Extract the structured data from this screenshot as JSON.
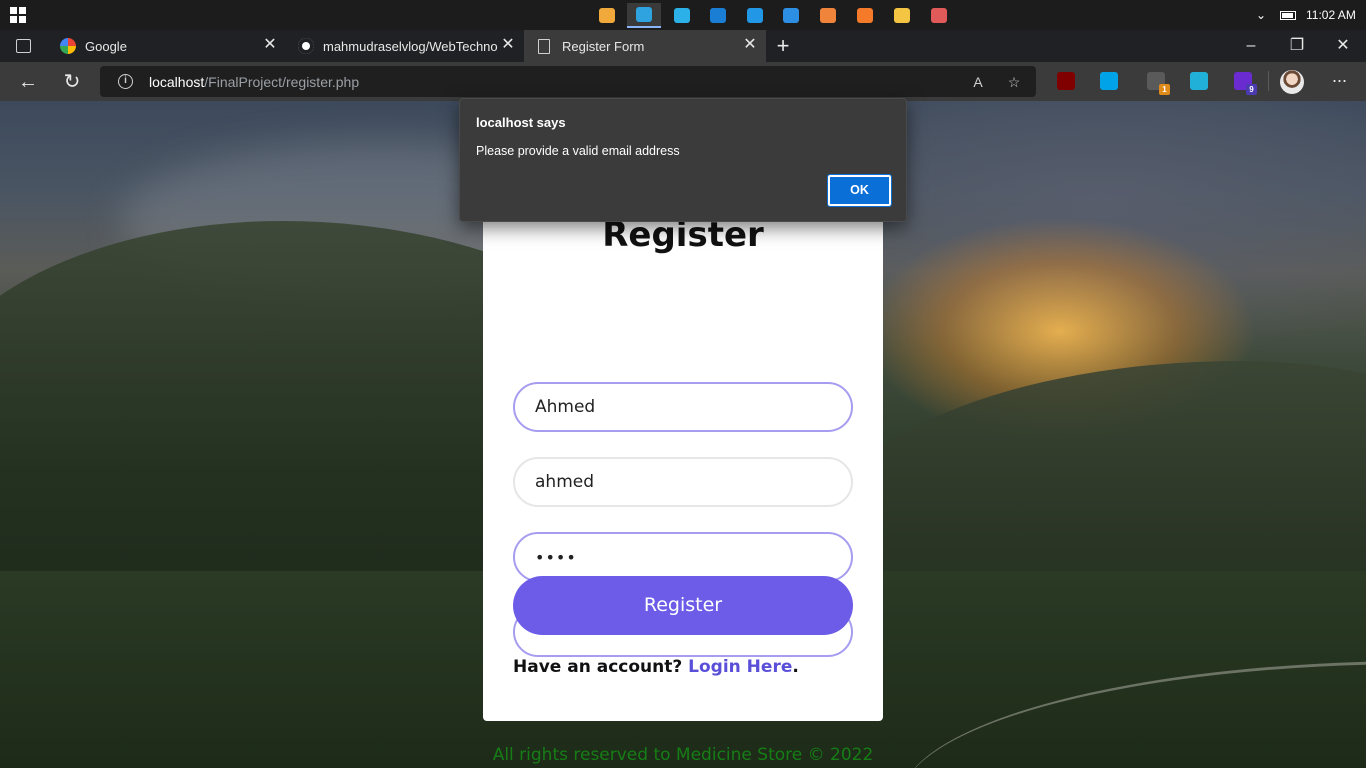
{
  "taskbar": {
    "apps": [
      {
        "name": "task-view",
        "color": "#f2a93b"
      },
      {
        "name": "edge",
        "color": "#2fa3e0",
        "active": true
      },
      {
        "name": "remote-app",
        "color": "#2bb1e8"
      },
      {
        "name": "monitor-app",
        "color": "#1a7fd4"
      },
      {
        "name": "store-app",
        "color": "#2197e6"
      },
      {
        "name": "vscode",
        "color": "#2d8fe3"
      },
      {
        "name": "sublime",
        "color": "#f0843a"
      },
      {
        "name": "xampp",
        "color": "#f57a2a"
      },
      {
        "name": "file-explorer",
        "color": "#f4c542"
      },
      {
        "name": "paint-app",
        "color": "#e05a5a"
      }
    ],
    "clock": "11:02 AM"
  },
  "browser": {
    "tabs": [
      {
        "label": "Google",
        "close": "✕"
      },
      {
        "label": "mahmudraselvlog/WebTechnolo",
        "close": "✕"
      },
      {
        "label": "Register Form",
        "close": "✕"
      }
    ],
    "new_tab": "+",
    "url_host": "localhost",
    "url_path": "/FinalProject/register.php",
    "extensions": [
      {
        "name": "ublock",
        "color": "#800000",
        "badge": ""
      },
      {
        "name": "skype",
        "color": "#00a3e8",
        "badge": ""
      },
      {
        "name": "people-ext",
        "color": "#5a5a5a",
        "badge": "1",
        "badge_color": "#e08a1a"
      },
      {
        "name": "remote-ext",
        "color": "#20b0d8",
        "badge": ""
      },
      {
        "name": "purple-ext",
        "color": "#6a2bd0",
        "badge": "9",
        "badge_color": "#4b3bb0"
      }
    ]
  },
  "page": {
    "title": "Register",
    "fields": {
      "name_value": "Ahmed",
      "username_value": "ahmed",
      "password_mask": "••••",
      "confirm_mask": "•••••"
    },
    "register_button": "Register",
    "login_prompt": "Have an account?",
    "login_link": "Login Here",
    "login_suffix": ".",
    "footer": "All rights reserved to Medicine Store © 2022"
  },
  "dialog": {
    "title": "localhost says",
    "message": "Please provide a valid email address",
    "ok_label": "OK"
  }
}
